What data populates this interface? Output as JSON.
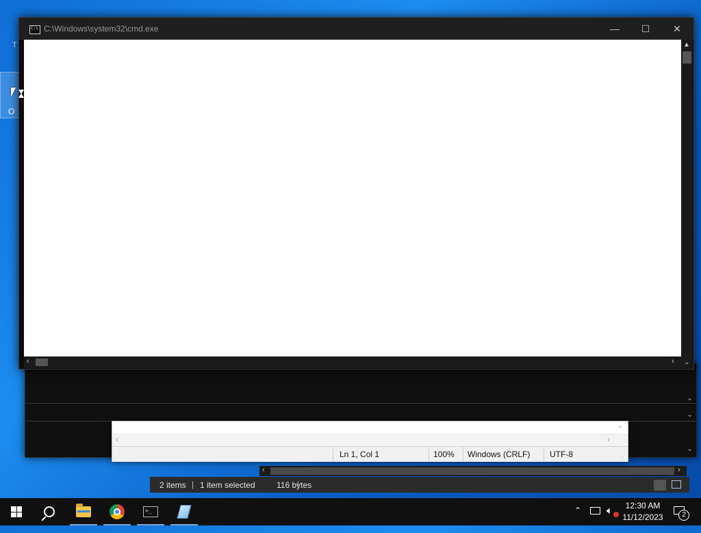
{
  "desktop": {
    "icon_letter": "O",
    "top_letter": "T"
  },
  "cmd_window": {
    "title": "C:\\Windows\\system32\\cmd.exe",
    "minimize_glyph": "—",
    "maximize_glyph": "☐",
    "close_glyph": "✕"
  },
  "notepad": {
    "status": {
      "position": "Ln 1, Col 1",
      "zoom": "100%",
      "line_ending": "Windows (CRLF)",
      "encoding": "UTF-8"
    }
  },
  "explorer": {
    "status": {
      "items": "2 items",
      "selected": "1 item selected",
      "size": "116 bytes"
    }
  },
  "taskbar": {
    "clock_time": "12:30 AM",
    "clock_date": "11/12/2023",
    "notification_count": "2"
  }
}
